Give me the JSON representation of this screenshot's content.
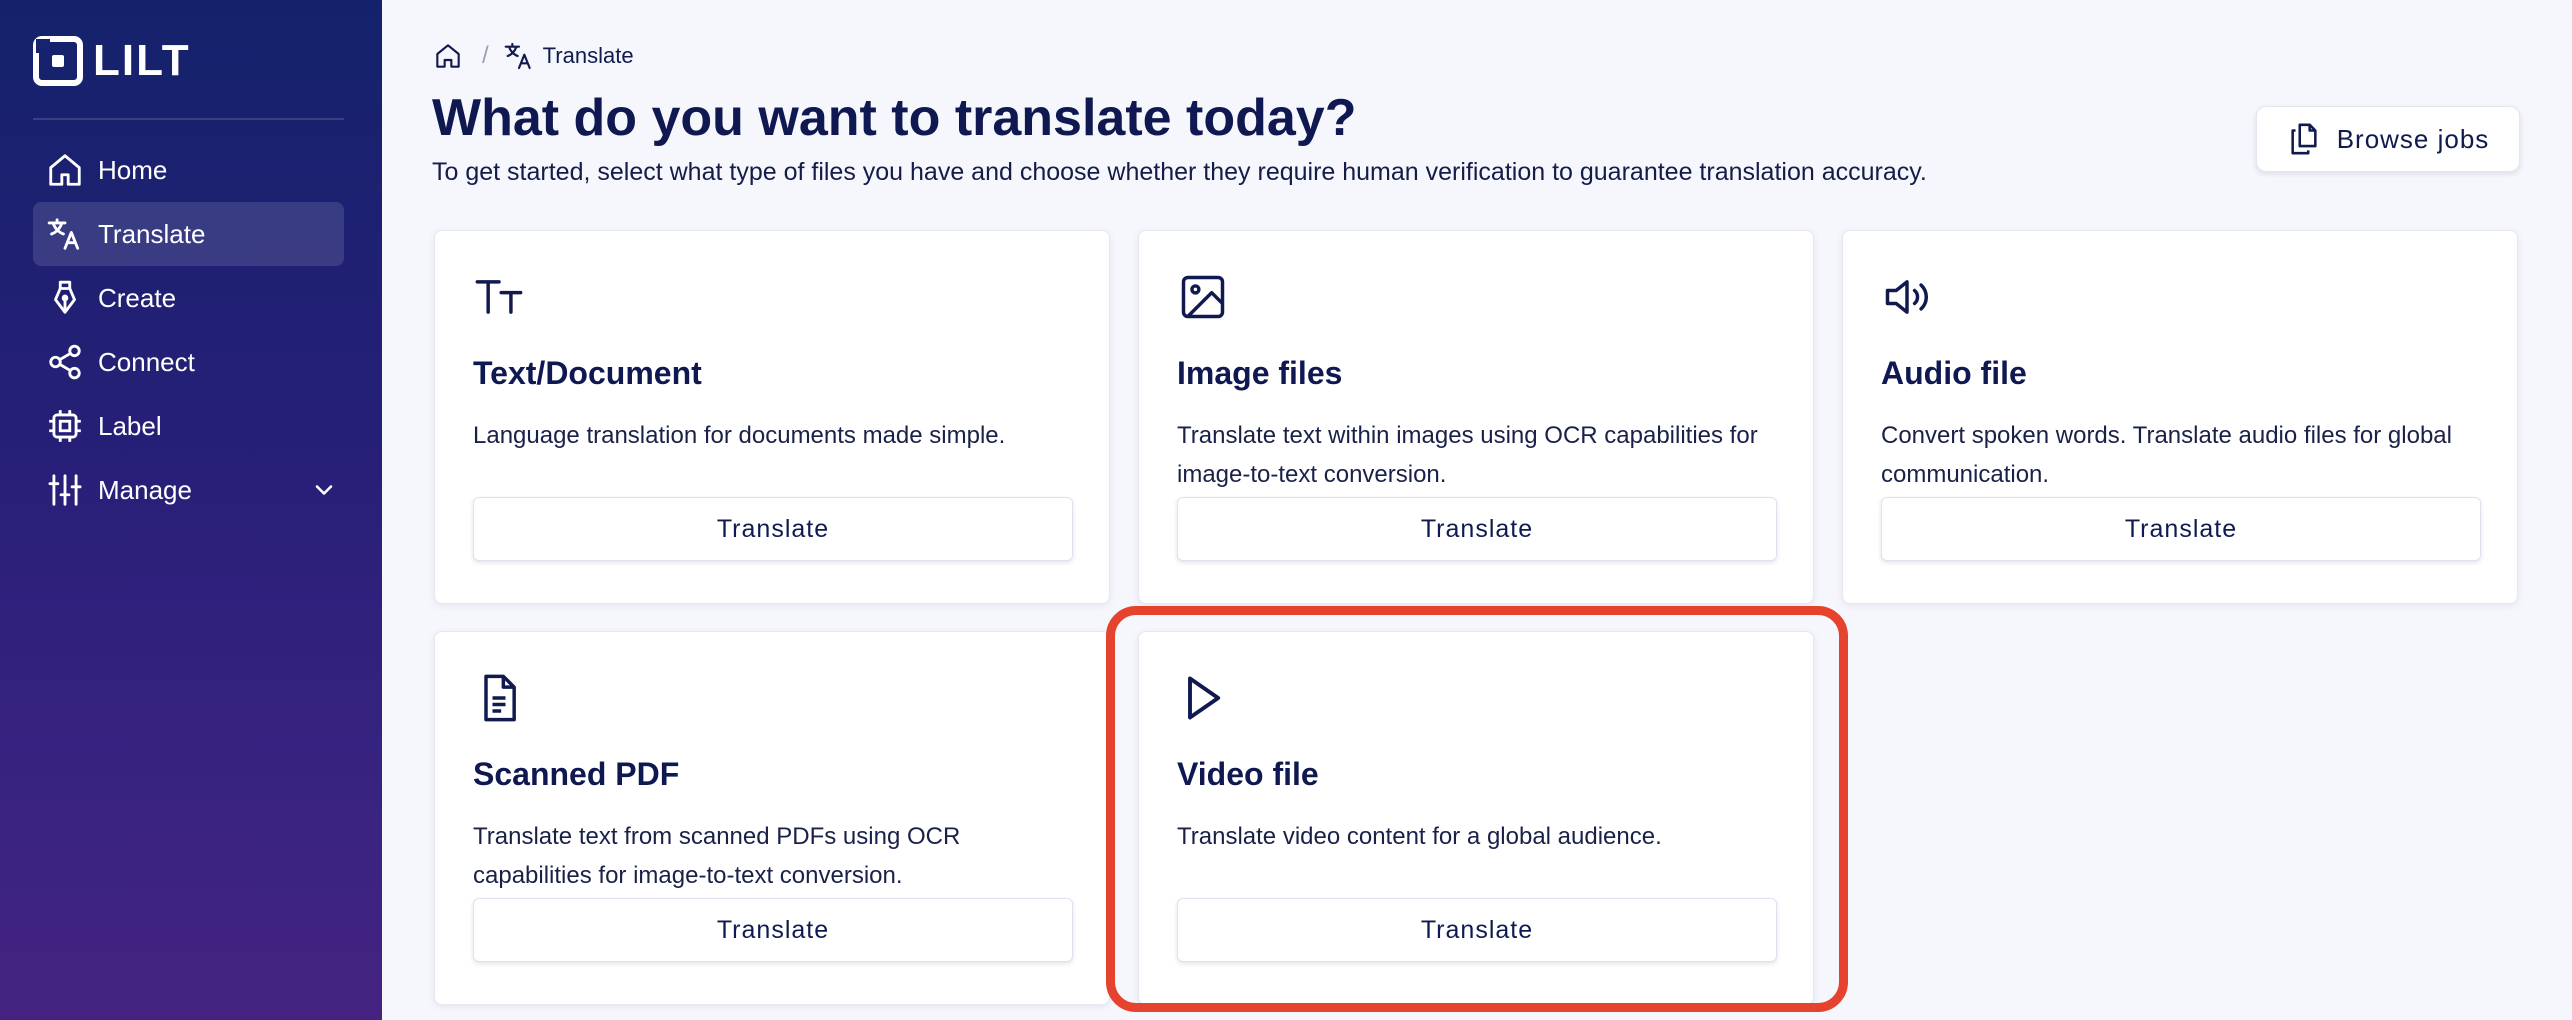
{
  "app": {
    "logo_text": "LILT"
  },
  "sidebar": {
    "items": [
      {
        "label": "Home",
        "icon": "home-icon"
      },
      {
        "label": "Translate",
        "icon": "translate-icon",
        "active": true
      },
      {
        "label": "Create",
        "icon": "pen-nib-icon"
      },
      {
        "label": "Connect",
        "icon": "share-nodes-icon"
      },
      {
        "label": "Label",
        "icon": "chip-icon"
      },
      {
        "label": "Manage",
        "icon": "sliders-icon",
        "expandable": true
      }
    ]
  },
  "breadcrumb": {
    "home_icon": "home-icon",
    "current_icon": "translate-icon",
    "current": "Translate"
  },
  "header": {
    "title": "What do you want to translate today?",
    "subtitle": "To get started, select what type of files you have and choose whether they require human verification to guarantee translation accuracy.",
    "browse_label": "Browse jobs",
    "browse_icon": "copy-files-icon"
  },
  "cards": [
    {
      "icon": "text-size-icon",
      "title": "Text/Document",
      "description": "Language translation for documents made simple.",
      "button": "Translate"
    },
    {
      "icon": "image-icon",
      "title": "Image files",
      "description": "Translate text within images using OCR capabilities for image-to-text conversion.",
      "button": "Translate"
    },
    {
      "icon": "speaker-icon",
      "title": "Audio file",
      "description": "Convert spoken words. Translate audio files for global communication.",
      "button": "Translate"
    },
    {
      "icon": "document-icon",
      "title": "Scanned PDF",
      "description": "Translate text from scanned PDFs using OCR capabilities for image-to-text conversion.",
      "button": "Translate"
    },
    {
      "icon": "play-icon",
      "title": "Video file",
      "description": "Translate video content for a global audience.",
      "button": "Translate",
      "highlighted": true
    }
  ],
  "colors": {
    "sidebar_top": "#14226b",
    "sidebar_bottom": "#442380",
    "title": "#0f1850",
    "highlight": "#e5432e",
    "background": "#f6f7fc"
  }
}
